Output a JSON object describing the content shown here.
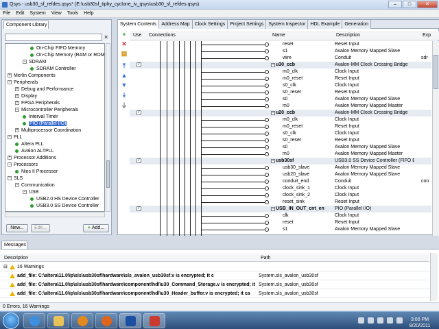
{
  "window": {
    "title": "Qsys - usb30_sf_refdes.qsys* (E:\\usb30sf_tiphy_cyclone_iv_qsys\\usb30_sf_refdes.qsys)"
  },
  "menu": [
    "File",
    "Edit",
    "System",
    "View",
    "Tools",
    "Help"
  ],
  "library": {
    "tab": "Component Library",
    "tree": [
      {
        "label": "On-Chip FIFO Memory",
        "level": 3,
        "type": "leaf"
      },
      {
        "label": "On-Chip Memory (RAM or ROM)",
        "level": 3,
        "type": "leaf"
      },
      {
        "label": "SDRAM",
        "level": 2,
        "type": "open"
      },
      {
        "label": "SDRAM Controller",
        "level": 3,
        "type": "leaf"
      },
      {
        "label": "Merlin Components",
        "level": 0,
        "type": "closed"
      },
      {
        "label": "Peripherals",
        "level": 0,
        "type": "open"
      },
      {
        "label": "Debug and Performance",
        "level": 1,
        "type": "closed"
      },
      {
        "label": "Display",
        "level": 1,
        "type": "closed"
      },
      {
        "label": "FPGA Peripherals",
        "level": 1,
        "type": "closed"
      },
      {
        "label": "Microcontroller Peripherals",
        "level": 1,
        "type": "open"
      },
      {
        "label": "Interval Timer",
        "level": 2,
        "type": "leaf"
      },
      {
        "label": "PIO (Parallel I/O)",
        "level": 2,
        "type": "leaf",
        "selected": true
      },
      {
        "label": "Multiprocessor Coordination",
        "level": 1,
        "type": "closed"
      },
      {
        "label": "PLL",
        "level": 0,
        "type": "open"
      },
      {
        "label": "Altera PLL",
        "level": 1,
        "type": "leaf"
      },
      {
        "label": "Avalon ALTPLL",
        "level": 1,
        "type": "leaf"
      },
      {
        "label": "Processor Additions",
        "level": 0,
        "type": "closed"
      },
      {
        "label": "Processors",
        "level": 0,
        "type": "open"
      },
      {
        "label": "Nios II Processor",
        "level": 1,
        "type": "leaf"
      },
      {
        "label": "SLS",
        "level": 0,
        "type": "open"
      },
      {
        "label": "Communication",
        "level": 1,
        "type": "open"
      },
      {
        "label": "USB",
        "level": 2,
        "type": "open"
      },
      {
        "label": "USB2.0 HS Device Controller",
        "level": 3,
        "type": "leaf"
      },
      {
        "label": "USB3.0 SS Device Controller",
        "level": 3,
        "type": "leaf"
      }
    ],
    "buttons": {
      "new": "New...",
      "edit": "Edit...",
      "add": "Add..."
    }
  },
  "tabs": [
    "System Contents",
    "Address Map",
    "Clock Settings",
    "Project Settings",
    "System Inspector",
    "HDL Example",
    "Generation"
  ],
  "table": {
    "headers": {
      "use": "Use",
      "connections": "Connections",
      "name": "Name",
      "description": "Description",
      "export": "Exp"
    },
    "rows": [
      {
        "name": "reset",
        "desc": "Reset Input",
        "exp": ""
      },
      {
        "name": "s1",
        "desc": "Avalon Memory Mapped Slave",
        "exp": ""
      },
      {
        "name": "wire",
        "desc": "Conduit",
        "exp": "sdr"
      },
      {
        "name": "u30_ccb",
        "desc": "Avalon-MM Clock Crossing Bridge",
        "exp": "",
        "module": true
      },
      {
        "name": "m0_clk",
        "desc": "Clock Input",
        "exp": ""
      },
      {
        "name": "m0_reset",
        "desc": "Reset Input",
        "exp": ""
      },
      {
        "name": "s0_clk",
        "desc": "Clock Input",
        "exp": ""
      },
      {
        "name": "s0_reset",
        "desc": "Reset Input",
        "exp": ""
      },
      {
        "name": "s0",
        "desc": "Avalon Memory Mapped Slave",
        "exp": ""
      },
      {
        "name": "m0",
        "desc": "Avalon Memory Mapped Master",
        "exp": ""
      },
      {
        "name": "u20_ccb",
        "desc": "Avalon-MM Clock Crossing Bridge",
        "exp": "",
        "module": true
      },
      {
        "name": "m0_clk",
        "desc": "Clock Input",
        "exp": ""
      },
      {
        "name": "m0_reset",
        "desc": "Reset Input",
        "exp": ""
      },
      {
        "name": "s0_clk",
        "desc": "Clock Input",
        "exp": ""
      },
      {
        "name": "s0_reset",
        "desc": "Reset Input",
        "exp": ""
      },
      {
        "name": "s0",
        "desc": "Avalon Memory Mapped Slave",
        "exp": ""
      },
      {
        "name": "m0",
        "desc": "Avalon Memory Mapped Master",
        "exp": ""
      },
      {
        "name": "usb30sf",
        "desc": "USB3.0 SS Device Controller (FIFO Ba...",
        "exp": "",
        "module": true
      },
      {
        "name": "usb30_slave",
        "desc": "Avalon Memory Mapped Slave",
        "exp": ""
      },
      {
        "name": "usb20_slave",
        "desc": "Avalon Memory Mapped Slave",
        "exp": ""
      },
      {
        "name": "conduit_end",
        "desc": "Conduit",
        "exp": "con"
      },
      {
        "name": "clock_sink_1",
        "desc": "Clock Input",
        "exp": ""
      },
      {
        "name": "clock_sink_2",
        "desc": "Clock Input",
        "exp": ""
      },
      {
        "name": "reset_sink",
        "desc": "Reset Input",
        "exp": ""
      },
      {
        "name": "USB_IN_OUT_cnt_en",
        "desc": "PIO (Parallel I/O)",
        "exp": "",
        "module": true
      },
      {
        "name": "clk",
        "desc": "Clock Input",
        "exp": ""
      },
      {
        "name": "reset",
        "desc": "Reset Input",
        "exp": ""
      },
      {
        "name": "s1",
        "desc": "Avalon Memory Mapped Slave",
        "exp": ""
      }
    ]
  },
  "messages": {
    "tab": "Messages",
    "headers": {
      "description": "Description",
      "path": "Path"
    },
    "group": "16 Warnings",
    "rows": [
      {
        "text": "add_file: C:\\altera\\11.0\\ip\\sls\\usb30sf\\hardware\\sls_avalon_usb30sf.v is encrypted; it c",
        "path": "System.sls_avalon_usb30sf"
      },
      {
        "text": "add_file: C:\\altera\\11.0\\ip\\sls\\usb30sf\\hardware\\component\\hdl\\u30_Command_Storage.v is encrypted; it ca",
        "path": "System.sls_avalon_usb30sf"
      },
      {
        "text": "add_file: C:\\altera\\11.0\\ip\\sls\\usb30sf\\hardware\\component\\hdl\\u30_Header_buffer.v is encrypted; it ca",
        "path": "System.sls_avalon_usb30sf"
      }
    ],
    "status": "0 Errors, 16 Warnings"
  },
  "taskbar": {
    "time": "3:00 PM",
    "date": "8/20/2011"
  }
}
